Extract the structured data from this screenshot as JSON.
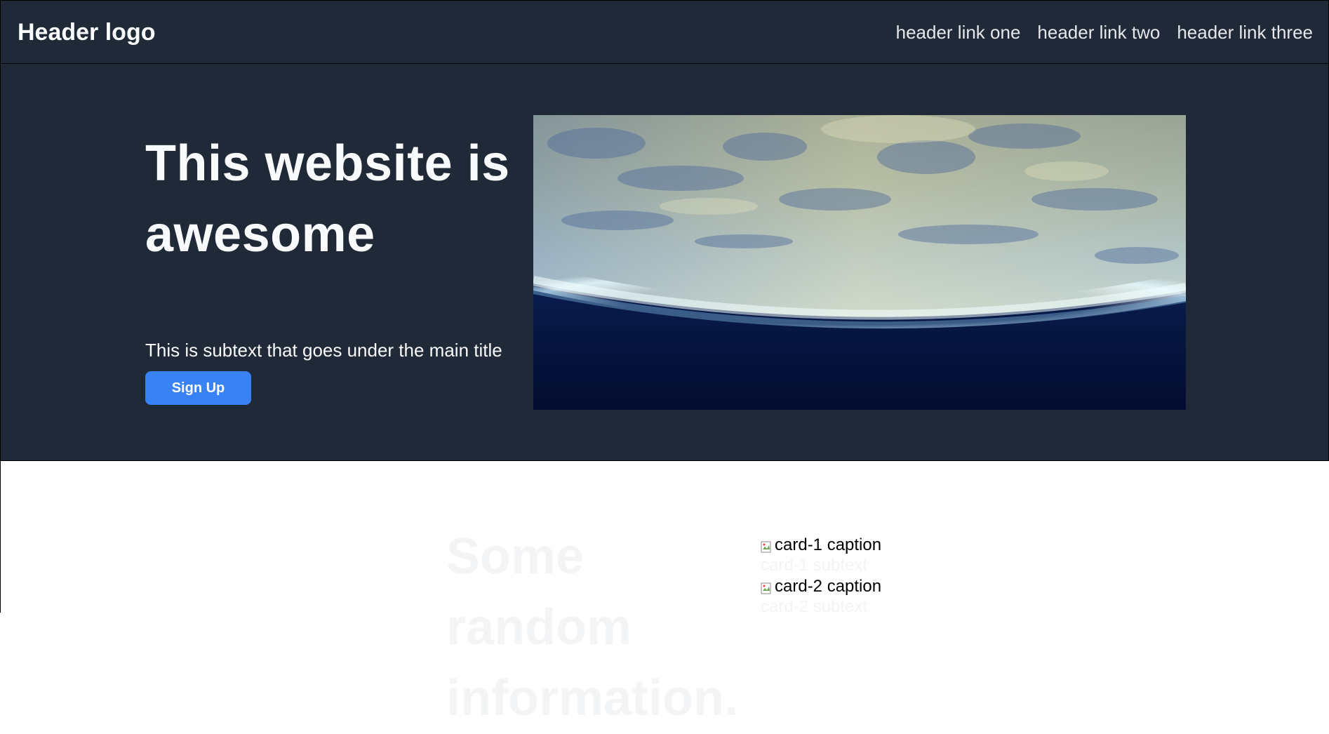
{
  "header": {
    "logo": "Header logo",
    "links": [
      {
        "label": "header link one"
      },
      {
        "label": "header link two"
      },
      {
        "label": "header link three"
      }
    ]
  },
  "hero": {
    "title": "This website is awesome",
    "subtext": "This is subtext that goes under the main title",
    "button_label": "Sign Up"
  },
  "lower": {
    "title": "Some random information.",
    "cards": [
      {
        "caption": "card-1 caption",
        "subtext": "card-1 subtext"
      },
      {
        "caption": "card-2 caption",
        "subtext": "card-2 subtext"
      }
    ]
  },
  "colors": {
    "header_bg": "#1f2937",
    "accent": "#3882f6",
    "faint_text": "#f3f4f6"
  }
}
